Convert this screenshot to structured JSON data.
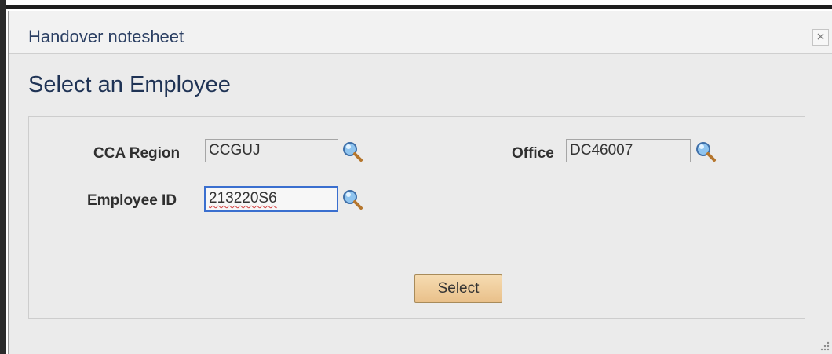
{
  "dialog": {
    "title": "Handover notesheet",
    "close_label": "×"
  },
  "page": {
    "title": "Select an Employee"
  },
  "form": {
    "cca_region": {
      "label": "CCA Region",
      "value": "CCGUJ"
    },
    "office": {
      "label": "Office",
      "value": "DC46007"
    },
    "employee_id": {
      "label": "Employee ID",
      "value": "213220S6"
    },
    "select_label": "Select"
  },
  "icons": {
    "lookup": "magnifier-lookup-icon",
    "close": "close-icon",
    "resize": "resize-grip-icon"
  },
  "colors": {
    "title": "#2b3f63",
    "button_top": "#f6dcb2",
    "button_bottom": "#e9c08a",
    "focus_border": "#3a6fcf"
  }
}
